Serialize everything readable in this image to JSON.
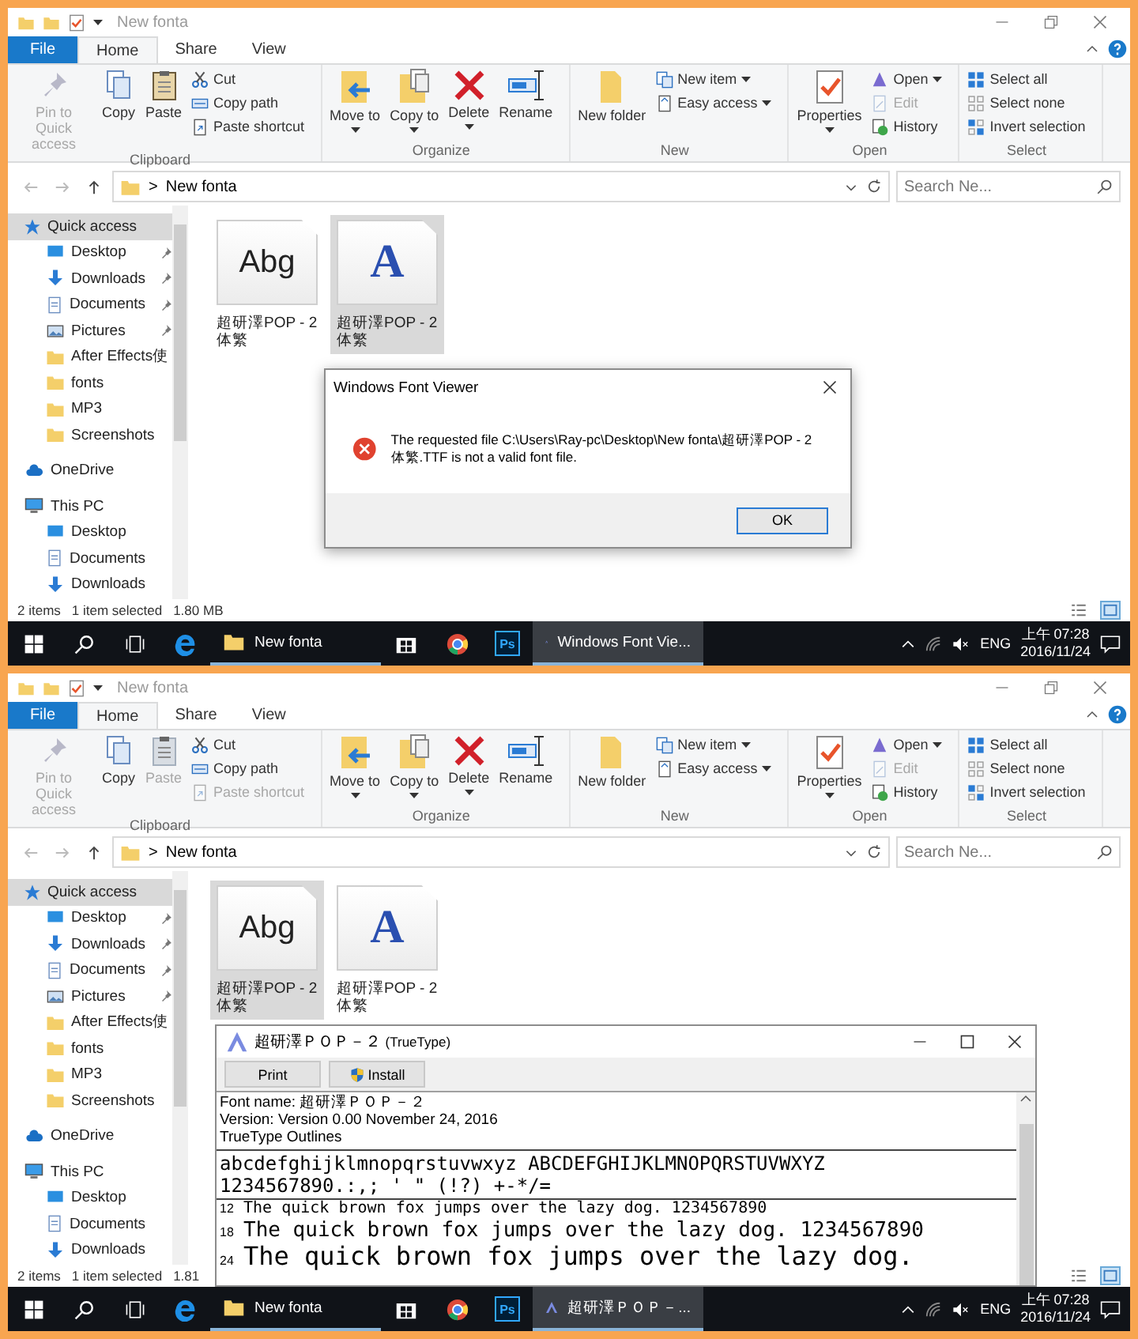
{
  "panels": [
    {
      "title": "New fonta",
      "tabs": [
        {
          "label": "File",
          "kind": "file",
          "selected": false
        },
        {
          "label": "Home",
          "kind": "tab",
          "selected": true
        },
        {
          "label": "Share",
          "kind": "tab",
          "selected": false
        },
        {
          "label": "View",
          "kind": "tab",
          "selected": false
        }
      ],
      "ribbon": [
        {
          "name": "Clipboard",
          "items": [
            {
              "kind": "large",
              "label": "Pin to Quick access",
              "dropdown": false,
              "disabled": true
            },
            {
              "kind": "large",
              "label": "Copy",
              "dropdown": false,
              "disabled": false
            },
            {
              "kind": "large",
              "label": "Paste",
              "dropdown": false,
              "disabled": false
            },
            {
              "kind": "small",
              "label": "Cut",
              "dropdown": false,
              "disabled": false
            },
            {
              "kind": "small",
              "label": "Copy path",
              "dropdown": false,
              "disabled": false
            },
            {
              "kind": "small",
              "label": "Paste shortcut",
              "dropdown": false,
              "disabled": false
            }
          ]
        },
        {
          "name": "Organize",
          "items": [
            {
              "kind": "large",
              "label": "Move to",
              "dropdown": true,
              "disabled": false
            },
            {
              "kind": "large",
              "label": "Copy to",
              "dropdown": true,
              "disabled": false
            },
            {
              "kind": "large",
              "label": "Delete",
              "dropdown": true,
              "disabled": false
            },
            {
              "kind": "large",
              "label": "Rename",
              "dropdown": false,
              "disabled": false
            }
          ]
        },
        {
          "name": "New",
          "items": [
            {
              "kind": "large",
              "label": "New folder",
              "dropdown": false,
              "disabled": false
            },
            {
              "kind": "small",
              "label": "New item",
              "dropdown": true,
              "disabled": false
            },
            {
              "kind": "small",
              "label": "Easy access",
              "dropdown": true,
              "disabled": false
            }
          ]
        },
        {
          "name": "Open",
          "items": [
            {
              "kind": "large",
              "label": "Properties",
              "dropdown": true,
              "disabled": false
            },
            {
              "kind": "small",
              "label": "Open",
              "dropdown": true,
              "disabled": false
            },
            {
              "kind": "small",
              "label": "Edit",
              "dropdown": false,
              "disabled": true
            },
            {
              "kind": "small",
              "label": "History",
              "dropdown": false,
              "disabled": false
            }
          ]
        },
        {
          "name": "Select",
          "items": [
            {
              "kind": "small",
              "label": "Select all",
              "dropdown": false,
              "disabled": false
            },
            {
              "kind": "small",
              "label": "Select none",
              "dropdown": false,
              "disabled": false
            },
            {
              "kind": "small",
              "label": "Invert selection",
              "dropdown": false,
              "disabled": false
            }
          ]
        }
      ],
      "address": {
        "separator": ">",
        "path": "New fonta",
        "search_placeholder": "Search Ne..."
      },
      "nav": [
        {
          "label": "Quick access",
          "kind": "star",
          "selected": true,
          "children": [
            {
              "label": "Desktop",
              "kind": "desktop",
              "pinned": true
            },
            {
              "label": "Downloads",
              "kind": "download",
              "pinned": true
            },
            {
              "label": "Documents",
              "kind": "document",
              "pinned": true
            },
            {
              "label": "Pictures",
              "kind": "picture",
              "pinned": true
            },
            {
              "label": "After Effects使",
              "kind": "folder",
              "pinned": false
            },
            {
              "label": "fonts",
              "kind": "folder",
              "pinned": false
            },
            {
              "label": "MP3",
              "kind": "folder",
              "pinned": false
            },
            {
              "label": "Screenshots",
              "kind": "folder",
              "pinned": false
            }
          ]
        },
        {
          "label": "OneDrive",
          "kind": "cloud",
          "selected": false
        },
        {
          "label": "This PC",
          "kind": "pc",
          "selected": false,
          "children": [
            {
              "label": "Desktop",
              "kind": "desktop",
              "pinned": false
            },
            {
              "label": "Documents",
              "kind": "document",
              "pinned": false
            },
            {
              "label": "Downloads",
              "kind": "download",
              "pinned": false
            }
          ]
        }
      ],
      "files": [
        {
          "thumb": "Abg",
          "kind": "sample",
          "label": "超研澤POP - 2 体繁",
          "selected": false
        },
        {
          "thumb": "A",
          "kind": "letter",
          "label": "超研澤POP - 2 体繁",
          "selected": true
        }
      ],
      "status": [
        "2 items",
        "1 item selected",
        "1.80 MB"
      ],
      "taskbar": {
        "apps": [
          {
            "kind": "start",
            "selected": false
          },
          {
            "kind": "search",
            "selected": false
          },
          {
            "kind": "taskview",
            "selected": false
          },
          {
            "kind": "edge",
            "selected": false
          },
          {
            "kind": "explorer",
            "label": "New fonta",
            "selected": false
          },
          {
            "kind": "store",
            "selected": false
          },
          {
            "kind": "chrome",
            "selected": false
          },
          {
            "kind": "ps",
            "text": "Ps",
            "selected": false
          },
          {
            "kind": "fontviewer",
            "label": "Windows Font Vie...",
            "selected": true
          }
        ],
        "lang": "ENG",
        "time": "上午 07:28",
        "date": "2016/11/24"
      },
      "overlay": {
        "kind": "dialog",
        "title": "Windows Font Viewer",
        "message": "The requested file C:\\Users\\Ray-pc\\Desktop\\New fonta\\超研澤POP - 2体繁.TTF is not a valid font file.",
        "button": "OK"
      }
    },
    {
      "title": "New fonta",
      "tabs": [
        {
          "label": "File",
          "kind": "file",
          "selected": false
        },
        {
          "label": "Home",
          "kind": "tab",
          "selected": true
        },
        {
          "label": "Share",
          "kind": "tab",
          "selected": false
        },
        {
          "label": "View",
          "kind": "tab",
          "selected": false
        }
      ],
      "ribbon": [
        {
          "name": "Clipboard",
          "items": [
            {
              "kind": "large",
              "label": "Pin to Quick access",
              "dropdown": false,
              "disabled": true
            },
            {
              "kind": "large",
              "label": "Copy",
              "dropdown": false,
              "disabled": false
            },
            {
              "kind": "large",
              "label": "Paste",
              "dropdown": false,
              "disabled": true
            },
            {
              "kind": "small",
              "label": "Cut",
              "dropdown": false,
              "disabled": false
            },
            {
              "kind": "small",
              "label": "Copy path",
              "dropdown": false,
              "disabled": false
            },
            {
              "kind": "small",
              "label": "Paste shortcut",
              "dropdown": false,
              "disabled": true
            }
          ]
        },
        {
          "name": "Organize",
          "items": [
            {
              "kind": "large",
              "label": "Move to",
              "dropdown": true,
              "disabled": false
            },
            {
              "kind": "large",
              "label": "Copy to",
              "dropdown": true,
              "disabled": false
            },
            {
              "kind": "large",
              "label": "Delete",
              "dropdown": true,
              "disabled": false
            },
            {
              "kind": "large",
              "label": "Rename",
              "dropdown": false,
              "disabled": false
            }
          ]
        },
        {
          "name": "New",
          "items": [
            {
              "kind": "large",
              "label": "New folder",
              "dropdown": false,
              "disabled": false
            },
            {
              "kind": "small",
              "label": "New item",
              "dropdown": true,
              "disabled": false
            },
            {
              "kind": "small",
              "label": "Easy access",
              "dropdown": true,
              "disabled": false
            }
          ]
        },
        {
          "name": "Open",
          "items": [
            {
              "kind": "large",
              "label": "Properties",
              "dropdown": true,
              "disabled": false
            },
            {
              "kind": "small",
              "label": "Open",
              "dropdown": true,
              "disabled": false
            },
            {
              "kind": "small",
              "label": "Edit",
              "dropdown": false,
              "disabled": true
            },
            {
              "kind": "small",
              "label": "History",
              "dropdown": false,
              "disabled": false
            }
          ]
        },
        {
          "name": "Select",
          "items": [
            {
              "kind": "small",
              "label": "Select all",
              "dropdown": false,
              "disabled": false
            },
            {
              "kind": "small",
              "label": "Select none",
              "dropdown": false,
              "disabled": false
            },
            {
              "kind": "small",
              "label": "Invert selection",
              "dropdown": false,
              "disabled": false
            }
          ]
        }
      ],
      "address": {
        "separator": ">",
        "path": "New fonta",
        "search_placeholder": "Search Ne..."
      },
      "nav": [
        {
          "label": "Quick access",
          "kind": "star",
          "selected": true,
          "children": [
            {
              "label": "Desktop",
              "kind": "desktop",
              "pinned": true
            },
            {
              "label": "Downloads",
              "kind": "download",
              "pinned": true
            },
            {
              "label": "Documents",
              "kind": "document",
              "pinned": true
            },
            {
              "label": "Pictures",
              "kind": "picture",
              "pinned": true
            },
            {
              "label": "After Effects使",
              "kind": "folder",
              "pinned": false
            },
            {
              "label": "fonts",
              "kind": "folder",
              "pinned": false
            },
            {
              "label": "MP3",
              "kind": "folder",
              "pinned": false
            },
            {
              "label": "Screenshots",
              "kind": "folder",
              "pinned": false
            }
          ]
        },
        {
          "label": "OneDrive",
          "kind": "cloud",
          "selected": false
        },
        {
          "label": "This PC",
          "kind": "pc",
          "selected": false,
          "children": [
            {
              "label": "Desktop",
              "kind": "desktop",
              "pinned": false
            },
            {
              "label": "Documents",
              "kind": "document",
              "pinned": false
            },
            {
              "label": "Downloads",
              "kind": "download",
              "pinned": false
            }
          ]
        }
      ],
      "files": [
        {
          "thumb": "Abg",
          "kind": "sample",
          "label": "超研澤POP - 2 体繁",
          "selected": true
        },
        {
          "thumb": "A",
          "kind": "letter",
          "label": "超研澤POP - 2 体繁",
          "selected": false
        }
      ],
      "status": [
        "2 items",
        "1 item selected",
        "1.81"
      ],
      "taskbar": {
        "apps": [
          {
            "kind": "start",
            "selected": false
          },
          {
            "kind": "search",
            "selected": false
          },
          {
            "kind": "taskview",
            "selected": false
          },
          {
            "kind": "edge",
            "selected": false
          },
          {
            "kind": "explorer",
            "label": "New fonta",
            "selected": false
          },
          {
            "kind": "store",
            "selected": false
          },
          {
            "kind": "chrome",
            "selected": false
          },
          {
            "kind": "ps",
            "text": "Ps",
            "selected": false
          },
          {
            "kind": "fontviewer",
            "label": "超研澤ＰＯＰ－...",
            "selected": true
          }
        ],
        "lang": "ENG",
        "time": "上午 07:28",
        "date": "2016/11/24"
      },
      "overlay": {
        "kind": "viewer",
        "title": "超研澤ＰＯＰ－２",
        "title_suffix": "(TrueType)",
        "buttons": [
          "Print",
          "Install"
        ],
        "info": [
          "Font name: 超研澤ＰＯＰ－２",
          "Version: Version 0.00 November 24, 2016",
          "TrueType Outlines"
        ],
        "charset": [
          "abcdefghijklmnopqrstuvwxyz ABCDEFGHIJKLMNOPQRSTUVWXYZ",
          "1234567890.:,; ' \" (!?) +-*/="
        ],
        "samples": [
          {
            "size": "12",
            "text": "The quick brown fox jumps over the lazy dog. 1234567890"
          },
          {
            "size": "18",
            "text": "The quick brown fox jumps over the lazy dog. 1234567890"
          },
          {
            "size": "24",
            "text": "The quick brown fox jumps over the lazy dog."
          }
        ]
      }
    }
  ]
}
